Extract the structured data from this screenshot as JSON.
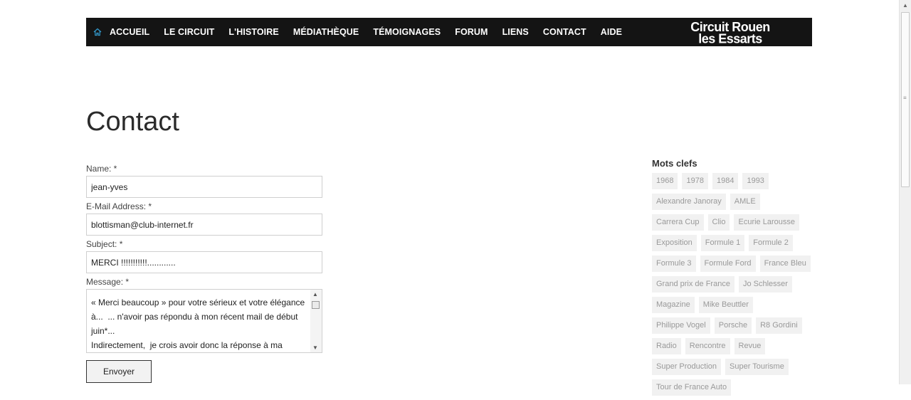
{
  "nav": {
    "items": [
      {
        "label": "ACCUEIL"
      },
      {
        "label": "LE CIRCUIT"
      },
      {
        "label": "L'HISTOIRE"
      },
      {
        "label": "MÉDIATHÈQUE"
      },
      {
        "label": "TÉMOIGNAGES"
      },
      {
        "label": "FORUM"
      },
      {
        "label": "LIENS"
      },
      {
        "label": "CONTACT"
      },
      {
        "label": "AIDE"
      }
    ],
    "logo_line1": "Circuit Rouen",
    "logo_line2": "les Essarts",
    "home_icon": "home-icon",
    "accent": "#3399cc",
    "bar_color": "#141414"
  },
  "page": {
    "title": "Contact"
  },
  "form": {
    "name_label": "Name: *",
    "name_value": "jean-yves",
    "email_label": "E-Mail Address: *",
    "email_value": "blottisman@club-internet.fr",
    "subject_label": "Subject: *",
    "subject_value": "MERCI !!!!!!!!!!!............",
    "message_label": "Message: *",
    "message_value": "« Merci beaucoup » pour votre sérieux et votre élégance à...  ... n'avoir pas répondu à mon récent mail de début juin*...\nIndirectement,  je crois avoir donc la réponse à ma",
    "submit_label": "Envoyer"
  },
  "tags": {
    "title": "Mots clefs",
    "items": [
      "1968",
      "1978",
      "1984",
      "1993",
      "Alexandre Janoray",
      "AMLE",
      "Carrera Cup",
      "Clio",
      "Ecurie Larousse",
      "Exposition",
      "Formule 1",
      "Formule 2",
      "Formule 3",
      "Formule Ford",
      "France Bleu",
      "Grand prix de France",
      "Jo Schlesser",
      "Magazine",
      "Mike Beuttler",
      "Philippe Vogel",
      "Porsche",
      "R8 Gordini",
      "Radio",
      "Rencontre",
      "Revue",
      "Super Production",
      "Super Tourisme",
      "Tour de France Auto"
    ]
  }
}
